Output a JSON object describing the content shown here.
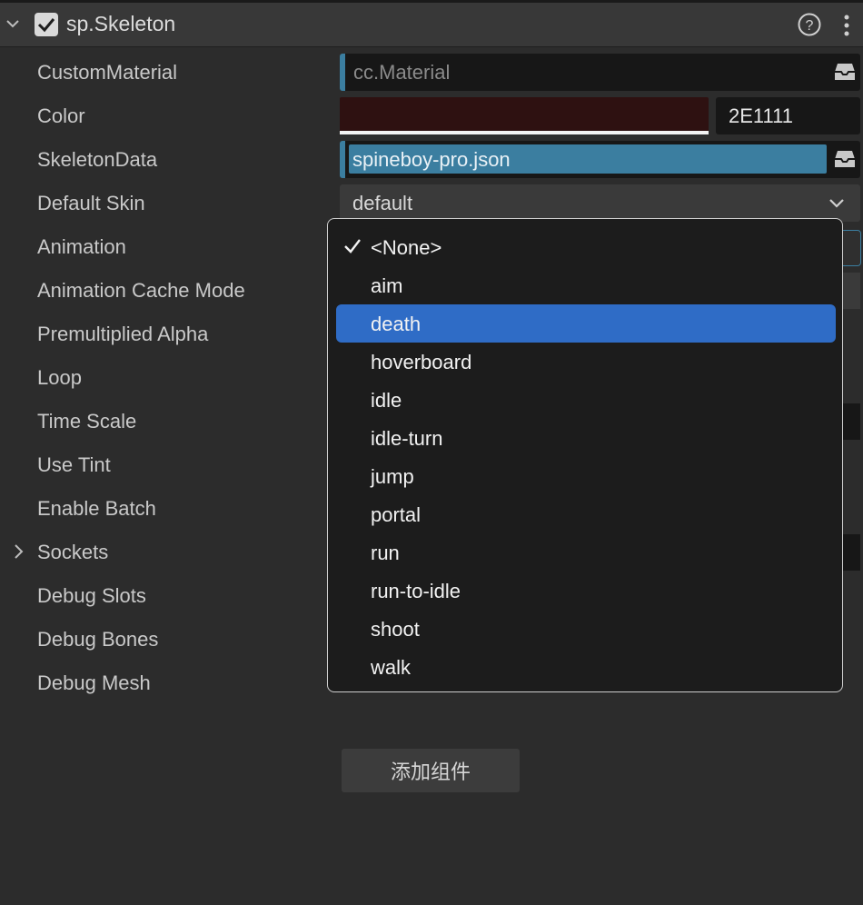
{
  "component": {
    "title": "sp.Skeleton",
    "enabled": true
  },
  "properties": [
    {
      "key": "custom_material",
      "label": "CustomMaterial"
    },
    {
      "key": "color",
      "label": "Color"
    },
    {
      "key": "skeleton_data",
      "label": "SkeletonData"
    },
    {
      "key": "default_skin",
      "label": "Default Skin"
    },
    {
      "key": "animation",
      "label": "Animation"
    },
    {
      "key": "animation_cache_mode",
      "label": "Animation Cache Mode"
    },
    {
      "key": "premultiplied_alpha",
      "label": "Premultiplied Alpha"
    },
    {
      "key": "loop",
      "label": "Loop"
    },
    {
      "key": "time_scale",
      "label": "Time Scale"
    },
    {
      "key": "use_tint",
      "label": "Use Tint"
    },
    {
      "key": "enable_batch",
      "label": "Enable Batch"
    },
    {
      "key": "sockets",
      "label": "Sockets"
    },
    {
      "key": "debug_slots",
      "label": "Debug Slots"
    },
    {
      "key": "debug_bones",
      "label": "Debug Bones"
    },
    {
      "key": "debug_mesh",
      "label": "Debug Mesh"
    }
  ],
  "fields": {
    "custom_material": {
      "placeholder": "cc.Material"
    },
    "color": {
      "swatch_hex": "#2E1111",
      "hex_value": "2E1111"
    },
    "skeleton_data": {
      "value": "spineboy-pro.json"
    },
    "default_skin": {
      "value": "default"
    }
  },
  "animation_menu": {
    "checked": "<None>",
    "highlighted": "death",
    "items": [
      "<None>",
      "aim",
      "death",
      "hoverboard",
      "idle",
      "idle-turn",
      "jump",
      "portal",
      "run",
      "run-to-idle",
      "shoot",
      "walk"
    ]
  },
  "add_component_label": "添加组件",
  "colors": {
    "panel_bg": "#2c2c2c",
    "header_bg": "#383838",
    "asset_accent": "#3b7ea0",
    "menu_highlight": "#2f6cc6"
  },
  "icons": {
    "collapse": "chevron-down-icon",
    "enabled": "checkbox-checked-icon",
    "help": "help-circle-icon",
    "more": "vertical-ellipsis-icon",
    "asset": "inbox-tray-icon",
    "expand": "chevron-right-icon",
    "check": "checkmark-icon"
  }
}
